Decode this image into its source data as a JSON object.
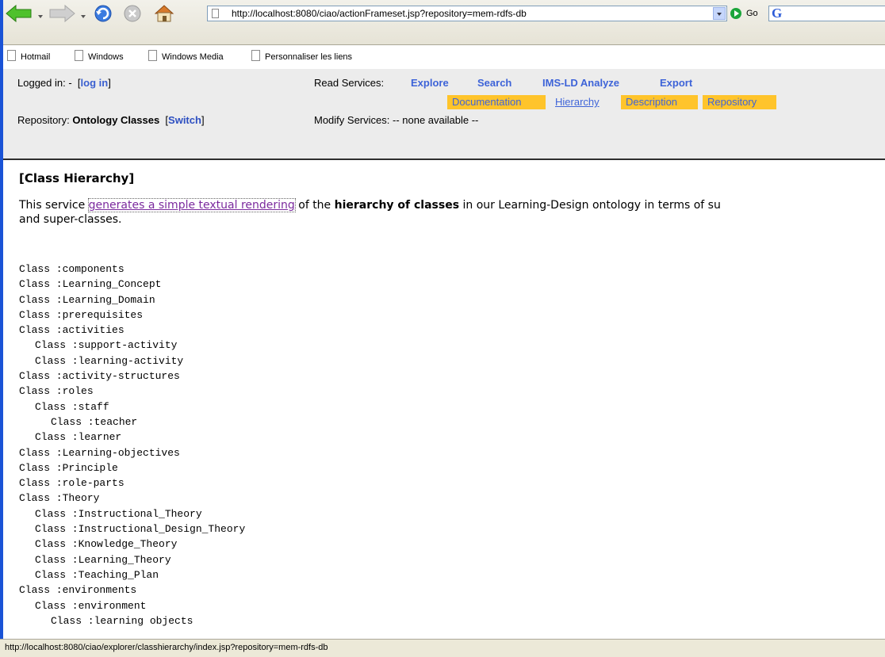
{
  "browser": {
    "address_url": "http://localhost:8080/ciao/actionFrameset.jsp?repository=mem-rdfs-db",
    "go_label": "Go",
    "bookmarks": [
      "Hotmail",
      "Windows",
      "Windows Media",
      "Personnaliser les liens"
    ]
  },
  "header": {
    "logged_in_label": "Logged in: -",
    "login_link": "log in",
    "repository_label": "Repository:",
    "repository_name": "Ontology Classes",
    "switch_link": "Switch",
    "read_services_label": "Read Services:",
    "read_services": [
      "Explore",
      "Search",
      "IMS-LD Analyze",
      "Export"
    ],
    "sub_tabs": [
      "Documentation",
      "Hierarchy",
      "Description",
      "Repository"
    ],
    "active_sub_tab": "Hierarchy",
    "modify_services_label": "Modify Services:",
    "modify_services_value": "-- none available --"
  },
  "content": {
    "title": "[Class Hierarchy]",
    "desc_prefix": "This service",
    "desc_link": "generates a simple textual rendering",
    "desc_middle": "of the",
    "desc_bold": "hierarchy of classes",
    "desc_suffix": "in our Learning-Design ontology in terms of su",
    "desc_line2": "and super-classes.",
    "hierarchy": [
      {
        "indent": 0,
        "text": "Class :components"
      },
      {
        "indent": 0,
        "text": "Class :Learning_Concept"
      },
      {
        "indent": 0,
        "text": "Class :Learning_Domain"
      },
      {
        "indent": 0,
        "text": "Class :prerequisites"
      },
      {
        "indent": 0,
        "text": "Class :activities"
      },
      {
        "indent": 1,
        "text": "Class :support-activity"
      },
      {
        "indent": 1,
        "text": "Class :learning-activity"
      },
      {
        "indent": 0,
        "text": "Class :activity-structures"
      },
      {
        "indent": 0,
        "text": "Class :roles"
      },
      {
        "indent": 1,
        "text": "Class :staff"
      },
      {
        "indent": 2,
        "text": "Class :teacher"
      },
      {
        "indent": 1,
        "text": "Class :learner"
      },
      {
        "indent": 0,
        "text": "Class :Learning-objectives"
      },
      {
        "indent": 0,
        "text": "Class :Principle"
      },
      {
        "indent": 0,
        "text": "Class :role-parts"
      },
      {
        "indent": 0,
        "text": "Class :Theory"
      },
      {
        "indent": 1,
        "text": "Class :Instructional_Theory"
      },
      {
        "indent": 1,
        "text": "Class :Instructional_Design_Theory"
      },
      {
        "indent": 1,
        "text": "Class :Knowledge_Theory"
      },
      {
        "indent": 1,
        "text": "Class :Learning_Theory"
      },
      {
        "indent": 1,
        "text": "Class :Teaching_Plan"
      },
      {
        "indent": 0,
        "text": "Class :environments"
      },
      {
        "indent": 1,
        "text": "Class :environment"
      },
      {
        "indent": 2,
        "text": "Class :learning objects"
      }
    ]
  },
  "status_bar": {
    "text": "http://localhost:8080/ciao/explorer/classhierarchy/index.jsp?repository=mem-rdfs-db"
  }
}
